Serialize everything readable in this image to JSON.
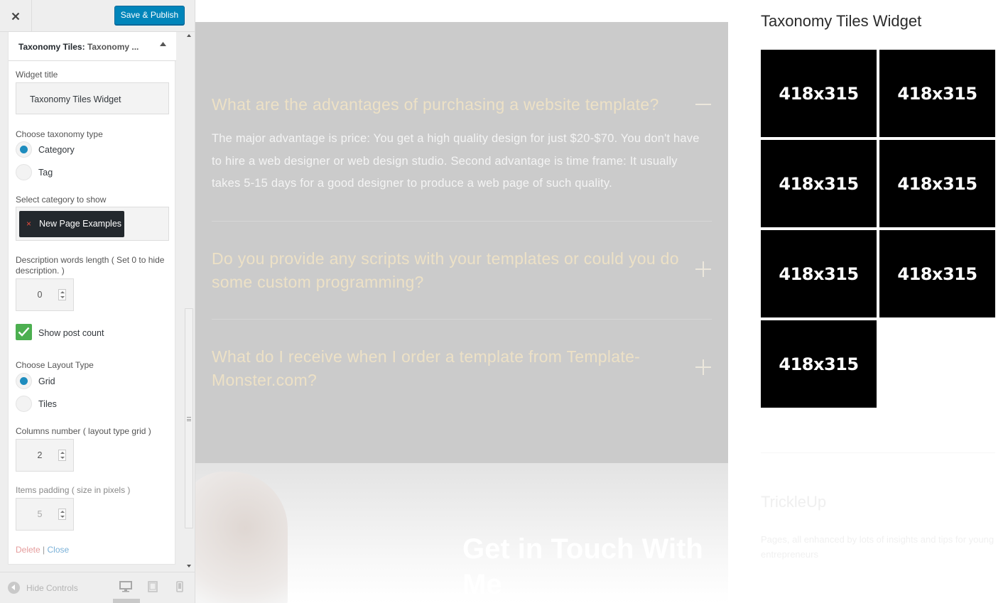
{
  "customizer": {
    "save_label": "Save & Publish",
    "widget": {
      "title_prefix": "Taxonomy Tiles:",
      "title_suffix": "Taxonomy ...",
      "fields": {
        "widget_title_label": "Widget title",
        "widget_title_value": "Taxonomy Tiles Widget",
        "taxonomy_type_label": "Choose taxonomy type",
        "taxonomy_options": [
          "Category",
          "Tag"
        ],
        "taxonomy_selected": "Category",
        "category_label": "Select category to show",
        "category_selected": "New Page Examples",
        "category_remove": "×",
        "desc_length_label": "Description words length ( Set 0 to hide description. )",
        "desc_length_value": "0",
        "show_post_count_label": "Show post count",
        "show_post_count_checked": true,
        "layout_type_label": "Choose Layout Type",
        "layout_options": [
          "Grid",
          "Tiles"
        ],
        "layout_selected": "Grid",
        "columns_label": "Columns number ( layout type grid )",
        "columns_value": "2",
        "padding_label": "Items padding ( size in pixels )",
        "padding_value": "5"
      },
      "actions": {
        "delete": "Delete",
        "separator": "|",
        "close": "Close"
      }
    },
    "footer": {
      "hide_controls": "Hide Controls"
    },
    "colors": {
      "primary_button": "#0085ba",
      "checkbox": "#4caf50",
      "radio": "#1e8cbe"
    }
  },
  "preview": {
    "faq": [
      {
        "question": "What are the advantages of purchasing a website template?",
        "answer": "The major advantage is price: You get a high quality design for just $20-$70. You don't have to hire a web designer or web design studio. Second advantage is time frame: It usually takes 5-15 days for a good designer to produce a web page of such quality.",
        "expanded": true
      },
      {
        "question": "Do you provide any scripts with your templates or could you do some custom programming?",
        "answer": "",
        "expanded": false
      },
      {
        "question": "What do I receive when I order a template from Template-Monster.com?",
        "answer": "",
        "expanded": false
      }
    ],
    "contact_title": "Get in Touch With Me",
    "sidebar": {
      "widget_title": "Taxonomy Tiles Widget",
      "tiles": [
        "418x315",
        "418x315",
        "418x315",
        "418x315",
        "418x315",
        "418x315",
        "418x315"
      ],
      "trickle_title": "TrickleUp",
      "trickle_desc": "Pages, all enhanced by lots of insights and tips for young entrepreneurs"
    }
  }
}
